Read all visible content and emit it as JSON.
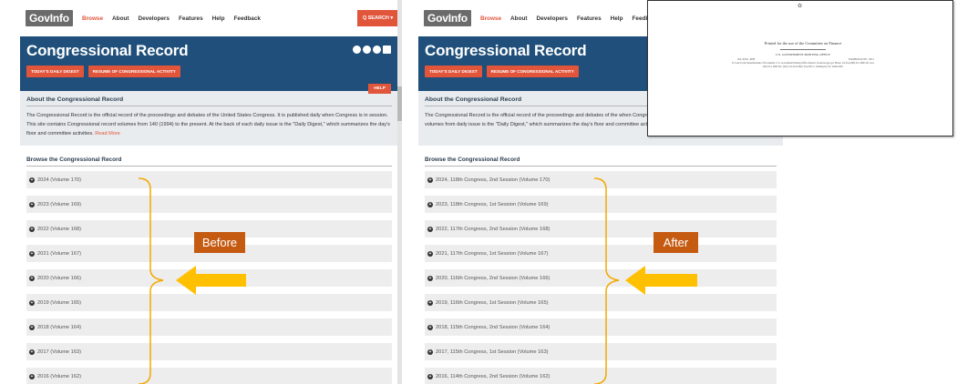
{
  "site": {
    "logo_gov": "Gov",
    "logo_info": "Info",
    "nav": [
      "Browse",
      "About",
      "Developers",
      "Features",
      "Help",
      "Feedback"
    ],
    "search_label": "Q SEARCH ▾",
    "page_title": "Congressional Record",
    "buttons": [
      "TODAY'S DAILY DIGEST",
      "RESUME OF CONGRESSIONAL ACTIVITY"
    ],
    "help_label": "HELP",
    "about_heading": "About the Congressional Record",
    "about_text_left": "The Congressional Record is the official record of the proceedings and debates of the United States Congress. It is published daily when Congress is in session. This site contains Congressional record volumes from 140 (1994) to the present. At the back of each daily issue is the \"Daily Digest,\" which summarizes the day's floor and committee activities.",
    "about_text_right": "The Congressional Record is the official record of the proceedings and debates of the when Congress is in session. This site contains Congressional record volumes from daily issue is the \"Daily Digest,\" which summarizes the day's floor and committee activities.",
    "read_more": "Read More",
    "browse_heading": "Browse the Congressional Record"
  },
  "before_years": [
    "2024 (Volume 170)",
    "2023 (Volume 169)",
    "2022 (Volume 168)",
    "2021 (Volume 167)",
    "2020 (Volume 166)",
    "2019 (Volume 165)",
    "2018 (Volume 164)",
    "2017 (Volume 163)",
    "2016 (Volume 162)"
  ],
  "after_years": [
    "2024, 118th Congress, 2nd Session (Volume 170)",
    "2023, 118th Congress, 1st Session (Volume 169)",
    "2022, 117th Congress, 2nd Session (Volume 168)",
    "2021, 117th Congress, 1st Session (Volume 167)",
    "2020, 116th Congress, 2nd Session (Volume 166)",
    "2019, 116th Congress, 1st Session (Volume 165)",
    "2018, 115th Congress, 2nd Session (Volume 164)",
    "2017, 115th Congress, 1st Session (Volume 163)",
    "2016, 114th Congress, 2nd Session (Volume 162)"
  ],
  "labels": {
    "before": "Before",
    "after": "After"
  },
  "document": {
    "printed_for": "Printed for the use of the Committee on Finance",
    "gpo": "U.S. GOVERNMENT PRINTING OFFICE",
    "gpo_left": "XX-XXX--PDF",
    "gpo_right": "WASHINGTON : 2011",
    "fine_print": "For sale by the Superintendent of Documents, U.S. Government Printing Office Internet: bookstore.gpo.gov Phone: toll free (866) 512-1800; DC area (202) 512-1800 Fax: (202) 512-2104 Mail: Stop IDCC, Washington, DC 20402-0001"
  },
  "colors": {
    "brand_orange": "#e1553b",
    "banner_blue": "#1f4f7a",
    "callout_orange": "#c55a11",
    "arrow_yellow": "#ffc000"
  }
}
